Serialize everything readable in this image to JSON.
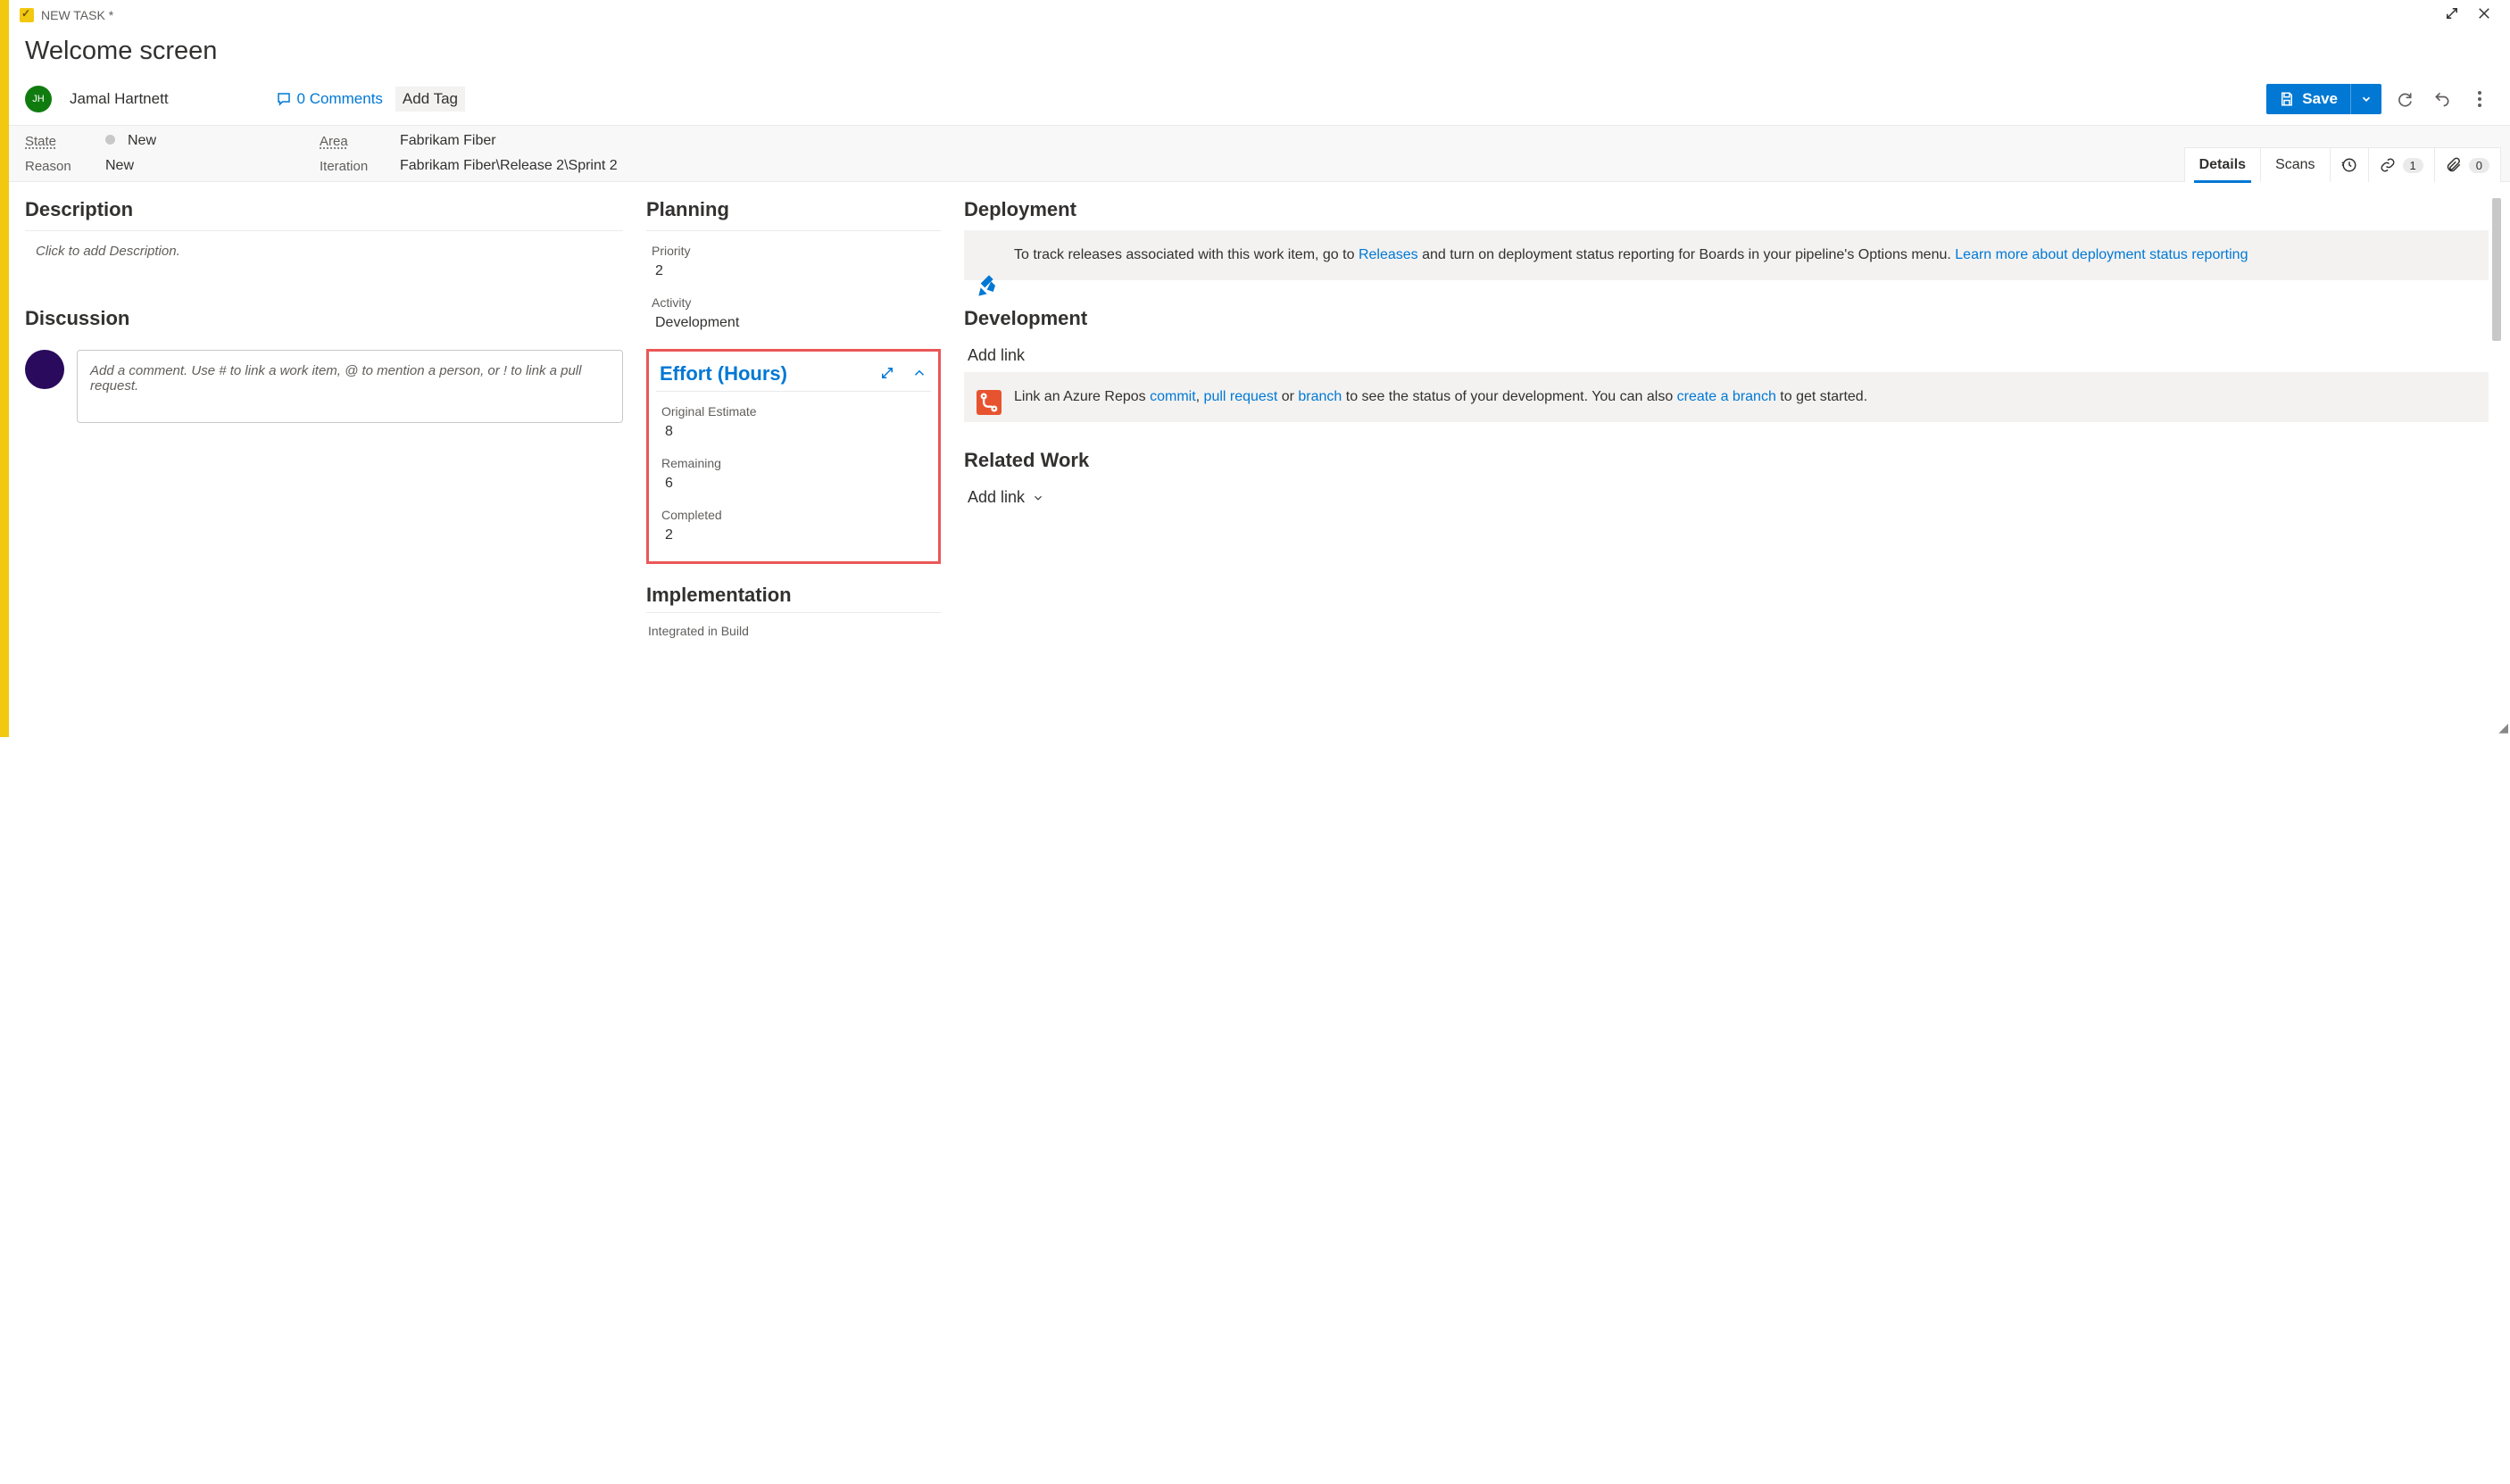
{
  "header": {
    "task_type": "NEW TASK *",
    "title": "Welcome screen",
    "avatar_initials": "JH",
    "user_name": "Jamal Hartnett",
    "comments": "0 Comments",
    "add_tag": "Add Tag",
    "save_label": "Save"
  },
  "classification": {
    "state_label": "State",
    "state_value": "New",
    "reason_label": "Reason",
    "reason_value": "New",
    "area_label": "Area",
    "area_value": "Fabrikam Fiber",
    "iteration_label": "Iteration",
    "iteration_value": "Fabrikam Fiber\\Release 2\\Sprint 2"
  },
  "tabs": {
    "details": "Details",
    "scans": "Scans",
    "links_count": "1",
    "attachments_count": "0"
  },
  "description": {
    "heading": "Description",
    "placeholder": "Click to add Description."
  },
  "discussion": {
    "heading": "Discussion",
    "placeholder": "Add a comment. Use # to link a work item, @ to mention a person, or ! to link a pull request."
  },
  "planning": {
    "heading": "Planning",
    "priority_label": "Priority",
    "priority_value": "2",
    "activity_label": "Activity",
    "activity_value": "Development"
  },
  "effort": {
    "heading": "Effort (Hours)",
    "original_label": "Original Estimate",
    "original_value": "8",
    "remaining_label": "Remaining",
    "remaining_value": "6",
    "completed_label": "Completed",
    "completed_value": "2"
  },
  "implementation": {
    "heading": "Implementation",
    "label": "Integrated in Build"
  },
  "deployment": {
    "heading": "Deployment",
    "text_pre": "To track releases associated with this work item, go to ",
    "releases_link": "Releases",
    "text_mid": " and turn on deployment status reporting for Boards in your pipeline's Options menu. ",
    "learn_link": "Learn more about deployment status reporting"
  },
  "development": {
    "heading": "Development",
    "add_link": "Add link",
    "text_pre": "Link an Azure Repos ",
    "commit_link": "commit",
    "sep1": ", ",
    "pr_link": "pull request",
    "sep_or": " or ",
    "branch_link": "branch",
    "text_mid": " to see the status of your development. You can also ",
    "create_link": "create a branch",
    "text_post": " to get started."
  },
  "related": {
    "heading": "Related Work",
    "add_link": "Add link"
  }
}
